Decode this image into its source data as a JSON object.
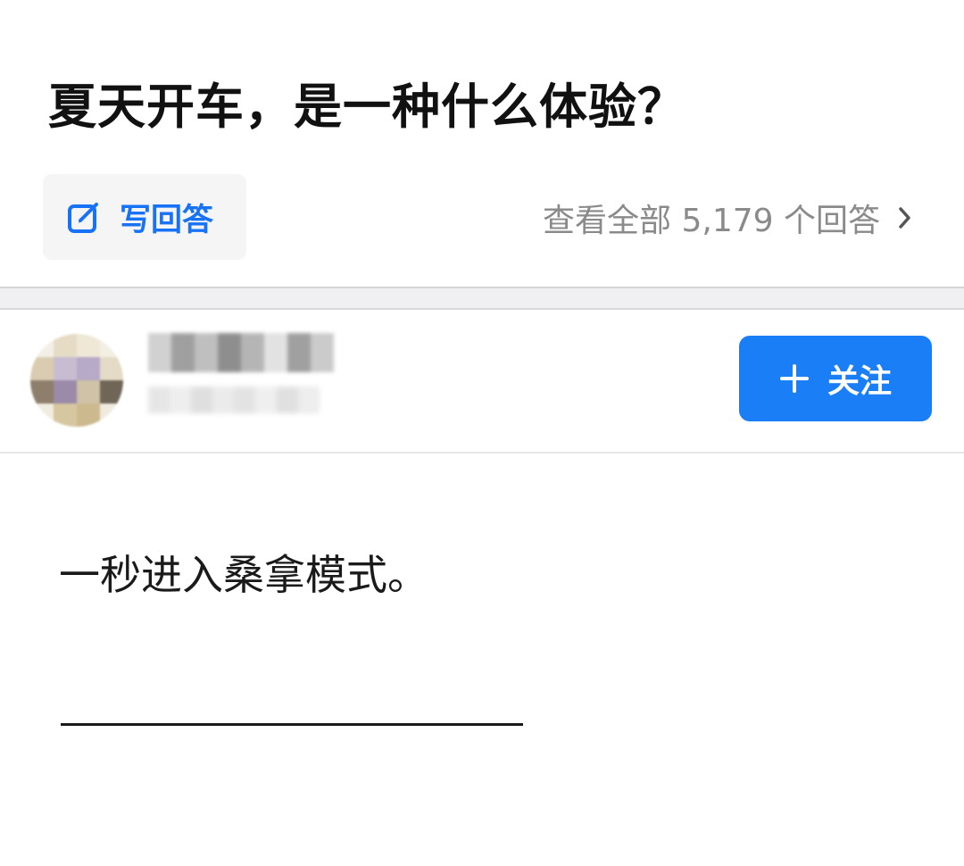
{
  "question": {
    "title": "夏天开车，是一种什么体验？"
  },
  "actions": {
    "write_answer_label": "写回答",
    "write_answer_icon": "edit-icon",
    "view_all_label": "查看全部 5,179 个回答",
    "view_all_icon": "chevron-right-icon"
  },
  "author": {
    "avatar_icon": "avatar",
    "name_obscured": true,
    "follow_label": "关注",
    "follow_icon": "plus-icon"
  },
  "answer": {
    "text": "一秒进入桑拿模式。"
  },
  "colors": {
    "accent": "#1a7ef7",
    "accent_text": "#1772f6",
    "muted_text": "#8a8a8a",
    "title_text": "#111111"
  }
}
